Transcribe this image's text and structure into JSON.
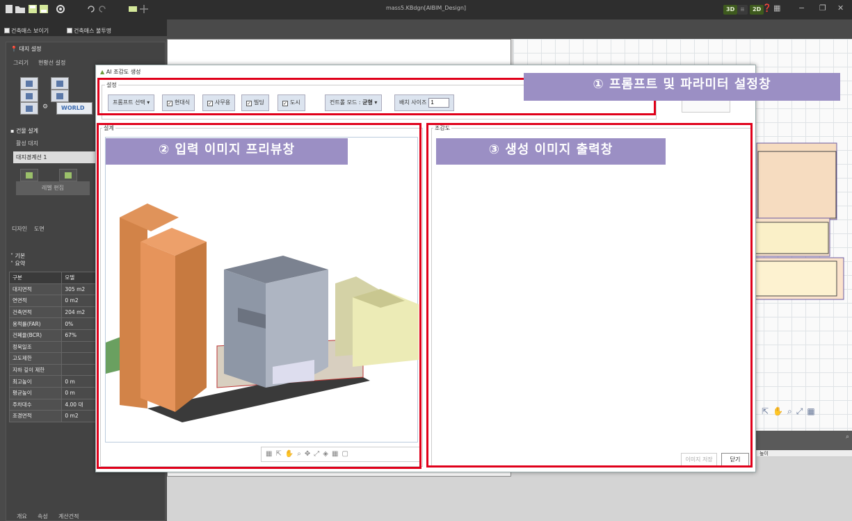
{
  "window": {
    "document_title": "mass5.KBdgn[AIBIM_Design]",
    "mode_3d": "3D",
    "mode_2d": "2D"
  },
  "checks": {
    "show_mass": "건축매스 보이기",
    "mass_transparent": "건축매스 불투명"
  },
  "left_panel": {
    "site_setting": "대지 설정",
    "tab_draw": "그리기",
    "tab_current": "현황선 설정",
    "world_label": "WORLD",
    "building_design": "건물 설계",
    "active_site_label": "활성 대지",
    "active_site_value": "대지경계선 1",
    "edit_button": "레벨 편집",
    "tab_design": "디자인",
    "tab_drawing": "도면",
    "section_basic": "기본",
    "section_summary": "요약",
    "summary_headers": [
      "구분",
      "모델"
    ],
    "summary_rows": [
      [
        "대지면적",
        "305 m2"
      ],
      [
        "연면적",
        "0 m2"
      ],
      [
        "건축면적",
        "204 m2"
      ],
      [
        "용적률(FAR)",
        "0%"
      ],
      [
        "건폐율(BCR)",
        "67%"
      ],
      [
        "정북일조",
        ""
      ],
      [
        "고도제한",
        ""
      ],
      [
        "지하 깊이 제한",
        ""
      ],
      [
        "최고높이",
        "0 m"
      ],
      [
        "평균높이",
        "0 m"
      ],
      [
        "주차대수",
        "4.00 대"
      ],
      [
        "조경면적",
        "0 m2"
      ]
    ],
    "bottom_tabs": [
      "개요",
      "속성",
      "계산건적"
    ]
  },
  "dialog": {
    "title": "AI 조감도 생성",
    "settings_label": "설정",
    "prompt_select": "프롬프트 선택",
    "opt_modern": "현대식",
    "opt_office": "사무용",
    "opt_building": "빌딩",
    "opt_city": "도시",
    "control_mode_label": "컨트롤 모드 : ",
    "control_mode_value": "균형",
    "batch_size_label": "배치 사이즈",
    "batch_size_value": "1",
    "design_label": "설계",
    "birdseye_label": "조감도",
    "save_image": "이미지 저장",
    "close": "닫기"
  },
  "callouts": {
    "c1": "① 프롬프트 및 파라미터 설정창",
    "c2": "② 입력 이미지 프리뷰창",
    "c3": "③ 생성 이미지 출력창"
  },
  "right_panel": {
    "height_label": "높이"
  },
  "colors": {
    "highlight_red": "#e0001a",
    "callout_purple": "#9b8fc4"
  }
}
